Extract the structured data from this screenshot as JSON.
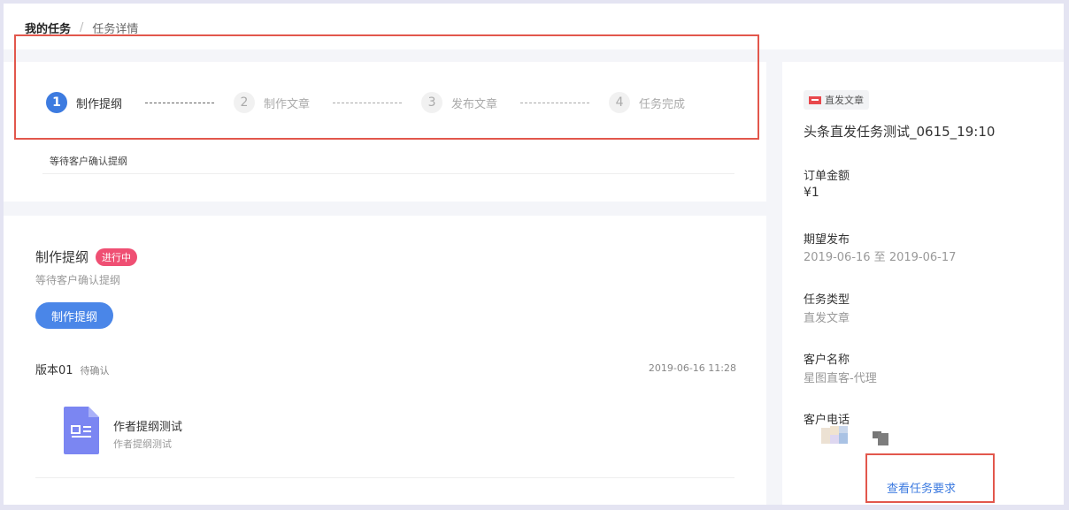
{
  "breadcrumb": {
    "root": "我的任务",
    "separator": "/",
    "current": "任务详情"
  },
  "steps": [
    {
      "num": "1",
      "label": "制作提纲"
    },
    {
      "num": "2",
      "label": "制作文章"
    },
    {
      "num": "3",
      "label": "发布文章"
    },
    {
      "num": "4",
      "label": "任务完成"
    }
  ],
  "step_hint": "等待客户确认提纲",
  "current_task": {
    "title": "制作提纲",
    "badge": "进行中",
    "subtitle": "等待客户确认提纲",
    "button": "制作提纲"
  },
  "version": {
    "name": "版本01",
    "status": "待确认",
    "time": "2019-06-16 11:28",
    "doc_title": "作者提纲测试",
    "doc_sub": "作者提纲测试"
  },
  "sidebar": {
    "tag": "直发文章",
    "title": "头条直发任务测试_0615_19:10",
    "fields": [
      {
        "label": "订单金额",
        "value": "¥1"
      },
      {
        "label": "期望发布",
        "value": "2019-06-16 至 2019-06-17"
      },
      {
        "label": "任务类型",
        "value": "直发文章"
      },
      {
        "label": "客户名称",
        "value": "星图直客-代理"
      },
      {
        "label": "客户电话",
        "value": ""
      }
    ],
    "link": "查看任务要求"
  },
  "colors": {
    "accent": "#3d7be0",
    "badge": "#ef4f73",
    "highlight_box": "#e2574c"
  }
}
